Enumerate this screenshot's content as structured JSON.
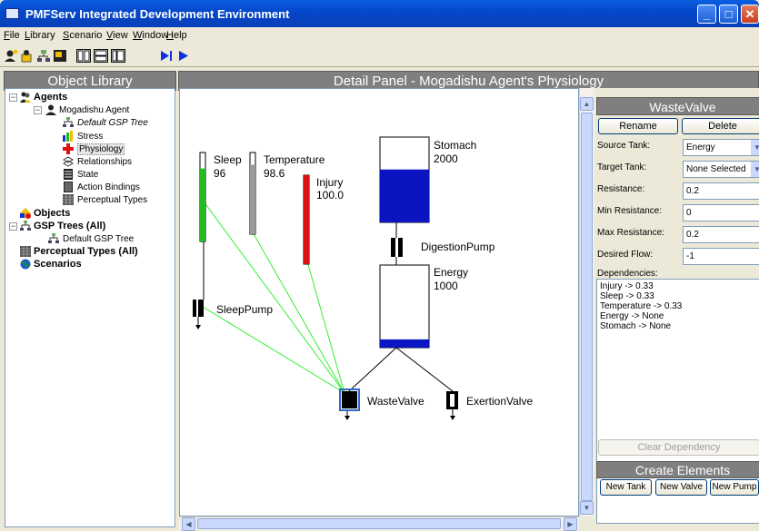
{
  "window": {
    "title": "PMFServ Integrated Development Environment"
  },
  "menu": [
    "File",
    "Library",
    "Scenario",
    "View",
    "Window",
    "Help"
  ],
  "library": {
    "header": "Object Library",
    "tree": {
      "agents": "Agents",
      "agent": "Mogadishu Agent",
      "default_gsp_italic": "Default GSP Tree",
      "stress": "Stress",
      "physiology": "Physiology",
      "relationships": "Relationships",
      "state": "State",
      "action_bindings": "Action Bindings",
      "perceptual_types": "Perceptual Types",
      "objects": "Objects",
      "gsp_trees": "GSP Trees (All)",
      "default_gsp": "Default GSP Tree",
      "perceptual_all": "Perceptual Types (All)",
      "scenarios": "Scenarios"
    }
  },
  "detail": {
    "header": "Detail Panel - Mogadishu Agent's Physiology",
    "tanks": {
      "sleep": {
        "name": "Sleep",
        "value": "96",
        "level": 0.82
      },
      "temperature": {
        "name": "Temperature",
        "value": "98.6",
        "level": 0.85
      },
      "injury": {
        "name": "Injury",
        "value": "100.0",
        "level": 1.0
      },
      "stomach": {
        "name": "Stomach",
        "value": "2000",
        "level": 0.62
      },
      "energy": {
        "name": "Energy",
        "value": "1000",
        "level": 0.1
      }
    },
    "pumps": {
      "sleep": "SleepPump",
      "digestion": "DigestionPump"
    },
    "valves": {
      "waste": "WasteValve",
      "exertion": "ExertionValve"
    }
  },
  "props": {
    "title": "WasteValve",
    "rename": "Rename",
    "delete": "Delete",
    "source_label": "Source Tank:",
    "source_value": "Energy",
    "target_label": "Target Tank:",
    "target_value": "None Selected",
    "resistance_label": "Resistance:",
    "resistance_value": "0.2",
    "min_label": "Min Resistance:",
    "min_value": "0",
    "max_label": "Max Resistance:",
    "max_value": "0.2",
    "flow_label": "Desired Flow:",
    "flow_value": "-1",
    "deps_label": "Dependencies:",
    "deps": [
      "Injury -> 0.33",
      "Sleep -> 0.33",
      "Temperature -> 0.33",
      "Energy -> None",
      "Stomach -> None"
    ],
    "clear": "Clear Dependency",
    "create_header": "Create Elements",
    "new_tank": "New Tank",
    "new_valve": "New Valve",
    "new_pump": "New Pump"
  },
  "colors": {
    "tank_blue": "#0a14c0",
    "sleep_green": "#22bb22",
    "injury_red": "#dd1111",
    "link_green": "#33ee33"
  }
}
